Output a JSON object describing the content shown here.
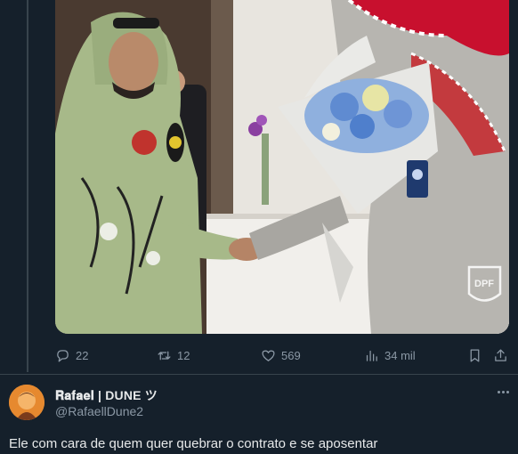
{
  "colors": {
    "background": "#15202b",
    "text": "#e7e9ea",
    "muted": "#8b98a5",
    "border": "#38444d"
  },
  "media": {
    "watermark": "DPF"
  },
  "actions": {
    "reply": {
      "icon": "reply-icon",
      "count": "22"
    },
    "retweet": {
      "icon": "retweet-icon",
      "count": "12"
    },
    "like": {
      "icon": "heart-icon",
      "count": "569"
    },
    "views": {
      "icon": "views-icon",
      "count": "34 mil"
    },
    "bookmark": {
      "icon": "bookmark-icon"
    },
    "share": {
      "icon": "share-icon"
    }
  },
  "reply_tweet": {
    "display_name": "𝐑𝐚𝐟𝐚𝐞𝐥 | DUNE ツ",
    "handle": "@RafaellDune2",
    "text": "Ele com cara de quem quer quebrar o contrato e se aposentar"
  }
}
